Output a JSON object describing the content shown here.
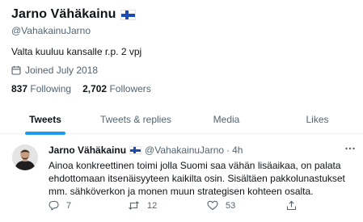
{
  "profile": {
    "name": "Jarno Vähäkainu",
    "handle": "@VahakainuJarno",
    "bio": "Valta kuuluu kansalle r.p. 2 vpj",
    "joined": "Joined July 2018",
    "following_count": "837",
    "following_label": "Following",
    "followers_count": "2,702",
    "followers_label": "Followers",
    "flag_icon": "finland-flag-icon"
  },
  "tabs": [
    {
      "label": "Tweets",
      "active": true
    },
    {
      "label": "Tweets & replies",
      "active": false
    },
    {
      "label": "Media",
      "active": false
    },
    {
      "label": "Likes",
      "active": false
    }
  ],
  "tweet": {
    "name": "Jarno Vähäkainu",
    "handle": "@VahakainuJarno",
    "separator": "·",
    "time": "4h",
    "text": "Ainoa konkreettinen toimi jolla Suomi saa vähän lisäaikaa, on palata ehdottomaan itsenäisyyteen kaikilta osin. Sisältäen pakkolunastukset mm. sähköverkon ja monen muun strategisen kohteen osalta.",
    "replies": "7",
    "retweets": "12",
    "likes": "53"
  },
  "colors": {
    "accent": "#1d9bf0",
    "text": "#0f1419",
    "secondary": "#536471",
    "flag_blue": "#1d4bb4"
  }
}
